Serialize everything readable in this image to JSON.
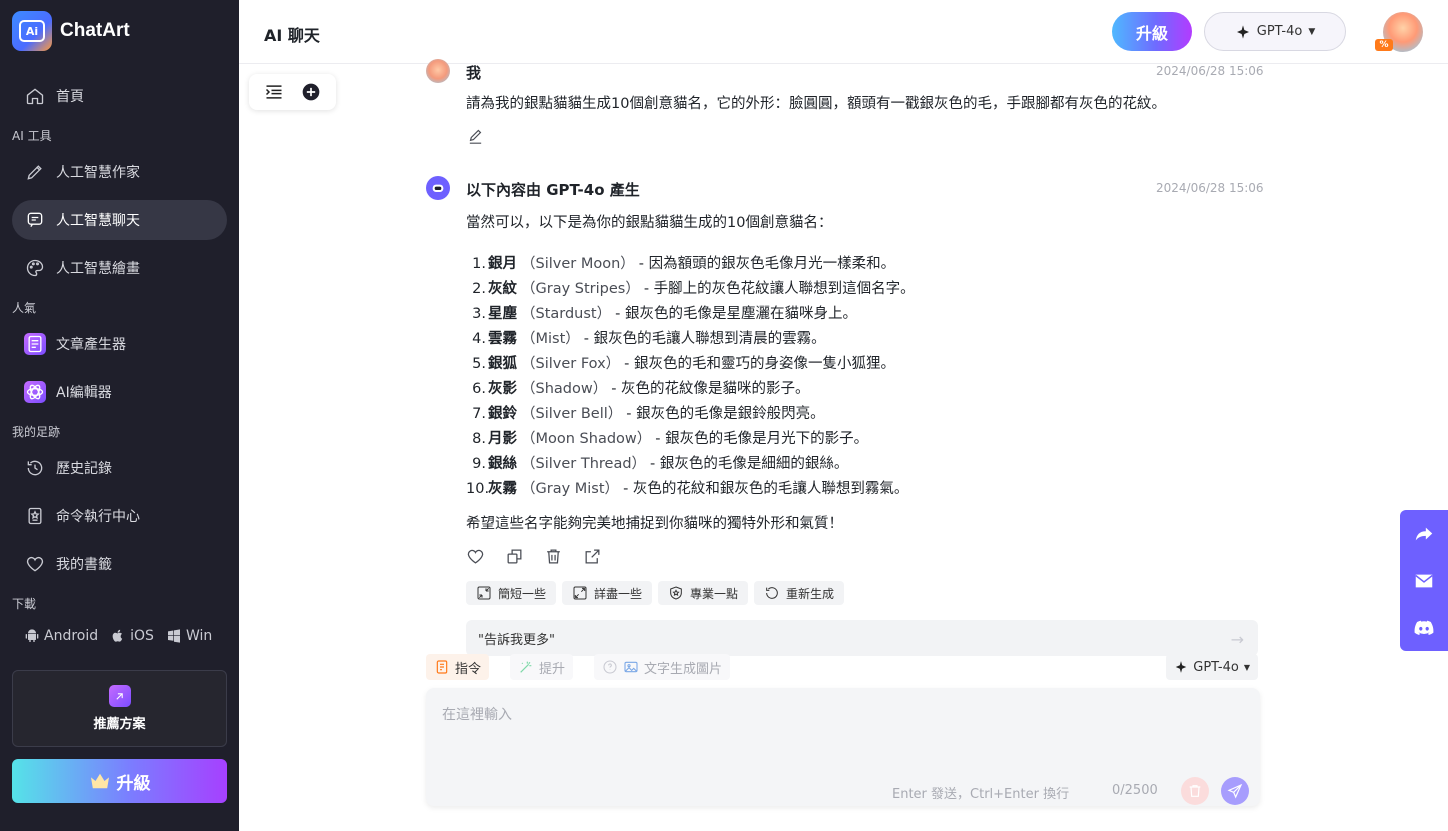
{
  "brand": {
    "name": "ChatArt",
    "logo_text": "Ai"
  },
  "sidebar": {
    "home": "首頁",
    "sections": {
      "ai_tools": "AI 工具",
      "popular": "人氣",
      "footprint": "我的足跡",
      "download": "下載"
    },
    "ai_tools": [
      {
        "label": "人工智慧作家",
        "icon": "pencil-icon"
      },
      {
        "label": "人工智慧聊天",
        "icon": "chat-icon",
        "active": true
      },
      {
        "label": "人工智慧繪畫",
        "icon": "palette-icon"
      }
    ],
    "popular": [
      {
        "label": "文章產生器",
        "icon": "article-icon"
      },
      {
        "label": "AI編輯器",
        "icon": "atom-icon"
      }
    ],
    "footprint": [
      {
        "label": "歷史記錄",
        "icon": "history-icon"
      },
      {
        "label": "命令執行中心",
        "icon": "command-icon"
      },
      {
        "label": "我的書籤",
        "icon": "heart-icon"
      }
    ],
    "downloads": [
      "Android",
      "iOS",
      "Win"
    ],
    "plan_card": "推薦方案",
    "upgrade": "升級"
  },
  "header": {
    "title": "AI 聊天",
    "upgrade": "升級",
    "model": "GPT-4o",
    "avatar_badge": "%"
  },
  "chat": {
    "user": {
      "name": "我",
      "time": "2024/06/28 15:06",
      "text": "請為我的銀點貓貓生成10個創意貓名，它的外形：臉圓圓，額頭有一戳銀灰色的毛，手跟腳都有灰色的花紋。"
    },
    "bot": {
      "name": "以下內容由 GPT-4o 產生",
      "time": "2024/06/28 15:06",
      "intro": "當然可以，以下是為你的銀點貓貓生成的10個創意貓名：",
      "items": [
        {
          "num": "1.",
          "term": "銀月",
          "en": "（Silver Moon）",
          "desc": " - 因為額頭的銀灰色毛像月光一樣柔和。"
        },
        {
          "num": "2.",
          "term": "灰紋",
          "en": "（Gray Stripes）",
          "desc": " - 手腳上的灰色花紋讓人聯想到這個名字。"
        },
        {
          "num": "3.",
          "term": "星塵",
          "en": "（Stardust）",
          "desc": " - 銀灰色的毛像是星塵灑在貓咪身上。"
        },
        {
          "num": "4.",
          "term": "雲霧",
          "en": "（Mist）",
          "desc": " - 銀灰色的毛讓人聯想到清晨的雲霧。"
        },
        {
          "num": "5.",
          "term": "銀狐",
          "en": "（Silver Fox）",
          "desc": " - 銀灰色的毛和靈巧的身姿像一隻小狐狸。"
        },
        {
          "num": "6.",
          "term": "灰影",
          "en": "（Shadow）",
          "desc": " - 灰色的花紋像是貓咪的影子。"
        },
        {
          "num": "7.",
          "term": "銀鈴",
          "en": "（Silver Bell）",
          "desc": " - 銀灰色的毛像是銀鈴般閃亮。"
        },
        {
          "num": "8.",
          "term": "月影",
          "en": "（Moon Shadow）",
          "desc": " - 銀灰色的毛像是月光下的影子。"
        },
        {
          "num": "9.",
          "term": "銀絲",
          "en": "（Silver Thread）",
          "desc": " - 銀灰色的毛像是細細的銀絲。"
        },
        {
          "num": "10.",
          "term": "灰霧",
          "en": "（Gray Mist）",
          "desc": " - 灰色的花紋和銀灰色的毛讓人聯想到霧氣。"
        }
      ],
      "outro": "希望這些名字能夠完美地捕捉到你貓咪的獨特外形和氣質！",
      "chips": [
        "簡短一些",
        "詳盡一些",
        "專業一點",
        "重新生成"
      ]
    },
    "suggestion": "\"告訴我更多\""
  },
  "composer": {
    "tabs": [
      "指令",
      "提升",
      "文字生成圖片"
    ],
    "model": "GPT-4o",
    "placeholder": "在這裡輸入",
    "hint": "Enter 發送，Ctrl+Enter 換行",
    "count": "0/2500"
  },
  "colors": {
    "sidebar_bg": "#1f1f2b",
    "accent_purple": "#6e60ff",
    "send_button": "#a79dfd"
  }
}
